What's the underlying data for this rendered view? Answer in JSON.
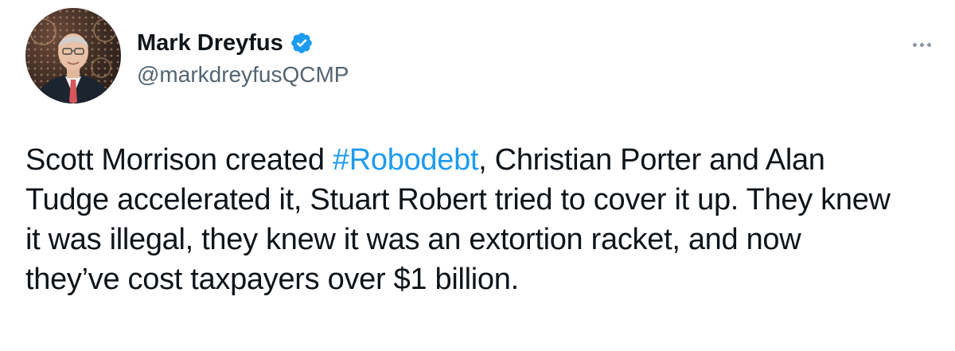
{
  "author": {
    "name": "Mark Dreyfus",
    "handle": "@markdreyfusQCMP",
    "verified": true,
    "avatar_icon": "profile-photo"
  },
  "menu": {
    "icon": "more-options-icon"
  },
  "tweet": {
    "line1_pre": "Scott Morrison created ",
    "hashtag": "#Robodebt",
    "line1_post": ", Christian Porter and Alan",
    "line2": "Tudge accelerated it, Stuart Robert tried to cover it up. They knew",
    "line3": "it was illegal, they knew it was an extortion racket, and now",
    "line4": "they’ve cost taxpayers over $1 billion."
  },
  "colors": {
    "link": "#1d9bf0",
    "verified_badge": "#1d9bf0",
    "secondary_text": "#536471",
    "primary_text": "#0f1419"
  }
}
